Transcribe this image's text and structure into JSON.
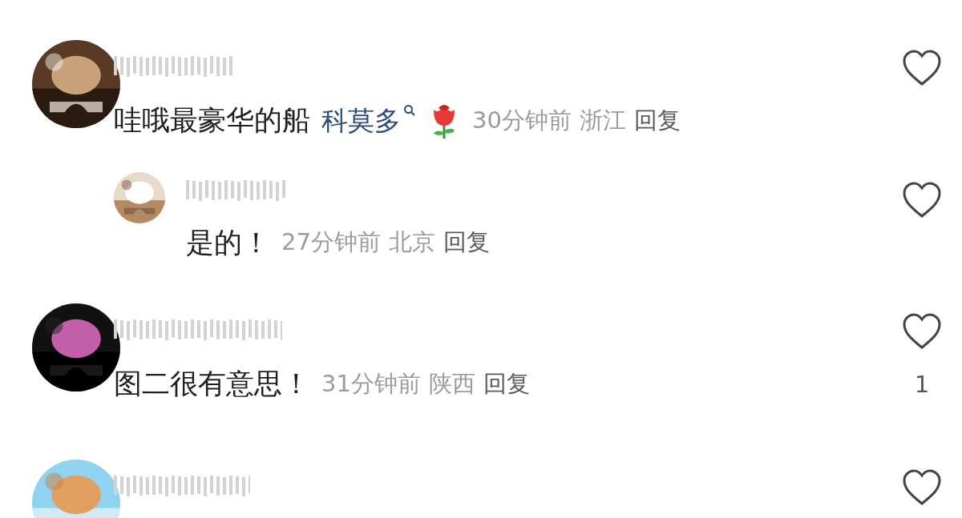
{
  "comments": [
    {
      "kind": "comment",
      "text": "哇哦最豪华的船",
      "mention": "科莫多",
      "time": "30分钟前",
      "location": "浙江",
      "reply": "回复",
      "liked": false
    },
    {
      "kind": "reply",
      "text": "是的！",
      "time": "27分钟前",
      "location": "北京",
      "reply": "回复",
      "liked": false
    },
    {
      "kind": "comment",
      "text": "图二很有意思！",
      "time": "31分钟前",
      "location": "陕西",
      "reply": "回复",
      "liked": false,
      "likes": "1"
    },
    {
      "kind": "comment",
      "liked": false
    }
  ]
}
